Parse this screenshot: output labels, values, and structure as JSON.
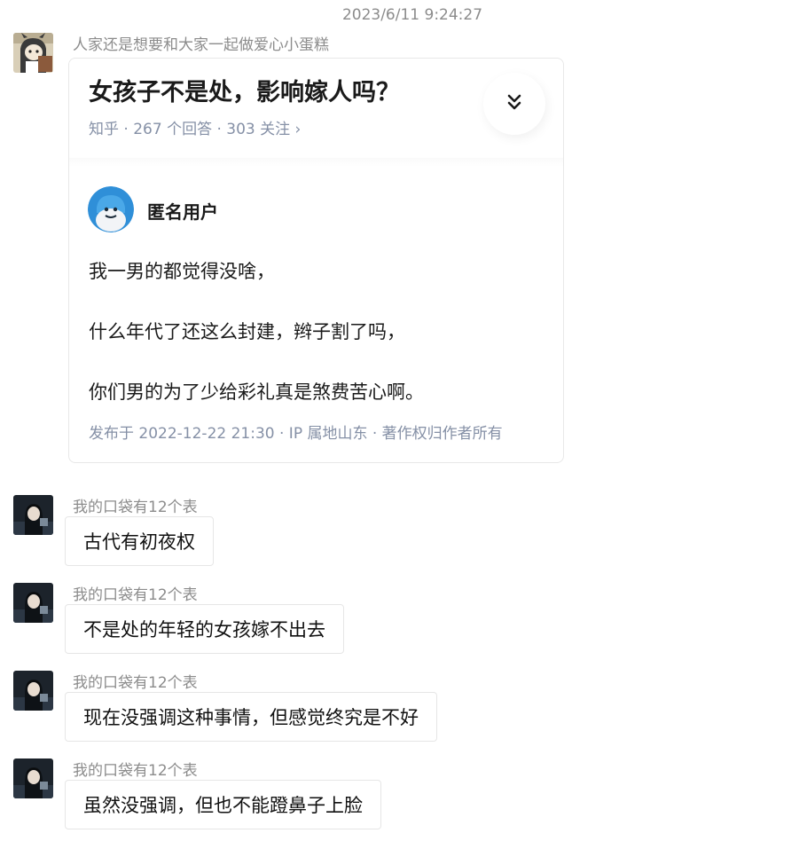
{
  "chat": {
    "timestamp": "2023/6/11 9:24:27",
    "messages": [
      {
        "sender": "人家还是想要和大家一起做爱心小蛋糕",
        "type": "image",
        "shared_card": {
          "title": "女孩子不是处，影响嫁人吗？",
          "meta": "知乎 · 267 个回答 · 303 关注 ›",
          "expand_icon": "double-chevron-down-icon",
          "answer_author": "匿名用户",
          "answer_lines": [
            "我一男的都觉得没啥，",
            "什么年代了还这么封建，辫子割了吗，",
            "你们男的为了少给彩礼真是煞费苦心啊。"
          ],
          "footer": "发布于 2022-12-22 21:30 · IP 属地山东 · 著作权归作者所有"
        }
      },
      {
        "sender": "我的口袋有12个表",
        "text": "古代有初夜权"
      },
      {
        "sender": "我的口袋有12个表",
        "text": "不是处的年轻的女孩嫁不出去"
      },
      {
        "sender": "我的口袋有12个表",
        "text": "现在没强调这种事情，但感觉终究是不好"
      },
      {
        "sender": "我的口袋有12个表",
        "text": "虽然没强调，但也不能蹬鼻子上脸"
      }
    ]
  },
  "colors": {
    "meta_gray": "#8c8c8c",
    "zhihu_meta": "#8590a6",
    "bubble_border": "#e6e6e6"
  }
}
